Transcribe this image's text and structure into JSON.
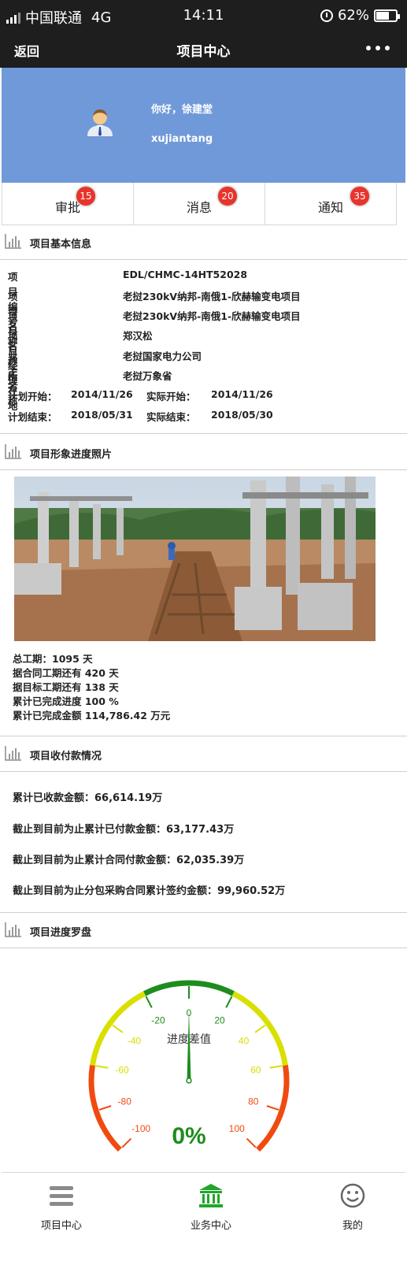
{
  "status_bar": {
    "carrier": "中国联通",
    "network": "4G",
    "time": "14:11",
    "battery": "62%",
    "battery_level": 0.62
  },
  "nav": {
    "back_label": "返回",
    "title": "项目中心"
  },
  "profile": {
    "greeting": "你好，徐建堂",
    "username": "xujiantang"
  },
  "tabs": [
    {
      "label": "审批",
      "badge": "15"
    },
    {
      "label": "消息",
      "badge": "20"
    },
    {
      "label": "通知",
      "badge": "35"
    }
  ],
  "sections": {
    "basic_info": "项目基本信息",
    "photos": "项目形象进度照片",
    "payments": "项目收付款情况",
    "compass": "项目进度罗盘"
  },
  "basic_info": {
    "rows": [
      {
        "key": "项目编号",
        "value": "EDL/CHMC-14HT52028"
      },
      {
        "key": "项目名称",
        "value": "老挝230kV纳邦-南俄1-欣赫输变电项目"
      },
      {
        "key": "项目名称",
        "value": "老挝230kV纳邦-南俄1-欣赫输变电项目"
      },
      {
        "key": "项目经理",
        "value": "郑汉松"
      },
      {
        "key": "业主名称",
        "value": "老挝国家电力公司"
      },
      {
        "key": "所在地",
        "value": "老挝万象省"
      }
    ],
    "plan_start_label": "计划开始：",
    "plan_start": "2014/11/26",
    "actual_start_label": "实际开始：",
    "actual_start": "2014/11/26",
    "plan_end_label": "计划结束：",
    "plan_end": "2018/05/31",
    "actual_end_label": "实际结束：",
    "actual_end": "2018/05/30"
  },
  "progress_stats": [
    "总工期：1095 天",
    "据合同工期还有 420 天",
    "据目标工期还有 138 天",
    "累计已完成进度 100 %",
    "累计已完成金额 114,786.42 万元"
  ],
  "payments": [
    "累计已收款金额：66,614.19万",
    "截止到目前为止累计已付款金额：63,177.43万",
    "截止到目前为止累计合同付款金额：62,035.39万",
    "截止到目前为止分包采购合同累计签约金额：99,960.52万"
  ],
  "gauge": {
    "title": "进度差值",
    "value_text": "0%",
    "value": 0,
    "min": -100,
    "max": 100,
    "tick_labels": [
      "-100",
      "-80",
      "-60",
      "-40",
      "-20",
      "0",
      "20",
      "40",
      "60",
      "80",
      "100"
    ],
    "colors": {
      "green": "#1e8c1e",
      "yellow": "#d8e000",
      "red": "#f04a10"
    }
  },
  "bottom_nav": [
    {
      "label": "项目中心",
      "icon": "list-icon"
    },
    {
      "label": "业务中心",
      "icon": "bank-icon"
    },
    {
      "label": "我的",
      "icon": "smiley-icon"
    }
  ]
}
